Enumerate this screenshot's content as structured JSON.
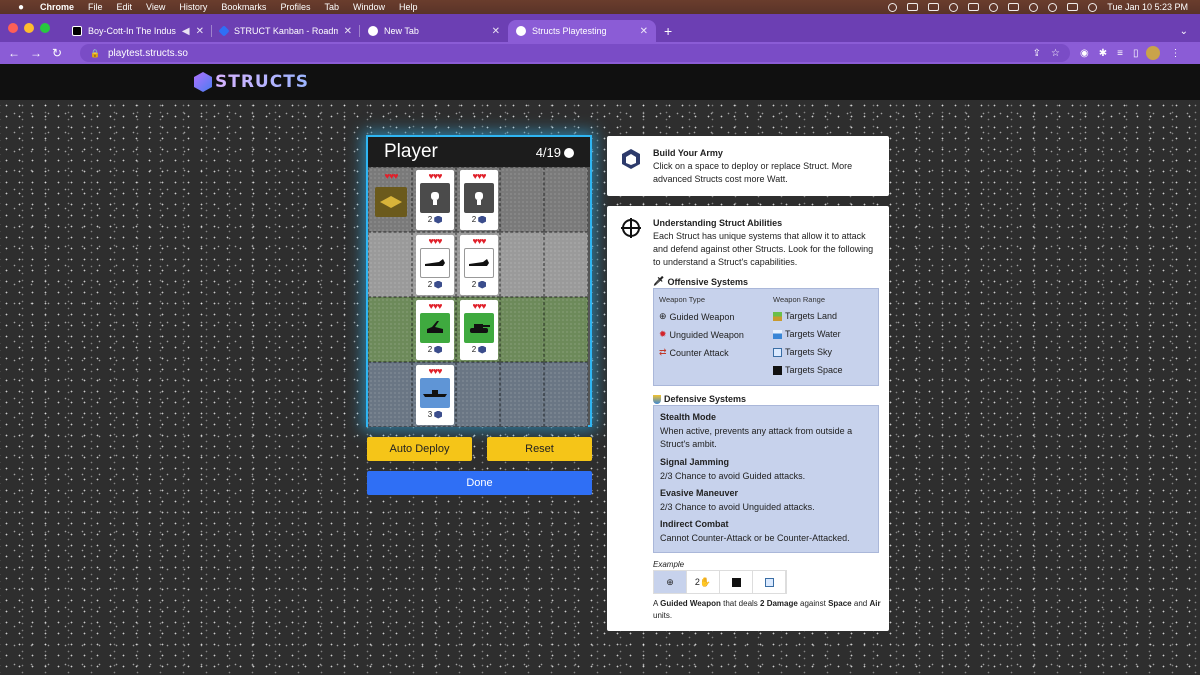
{
  "menubar": {
    "app": "Chrome",
    "items": [
      "File",
      "Edit",
      "View",
      "History",
      "Bookmarks",
      "Profiles",
      "Tab",
      "Window",
      "Help"
    ],
    "clock": "Tue Jan 10  5:23 PM"
  },
  "tabs": [
    {
      "title": "Boy-Cott-In The Industry |",
      "favicon_color": "#000000"
    },
    {
      "title": "STRUCT Kanban - Roadmap -",
      "favicon_color": "#2f6ff5"
    },
    {
      "title": "New Tab",
      "favicon_color": "#ffffff"
    },
    {
      "title": "Structs Playtesting",
      "favicon_color": "#ffffff",
      "active": true
    }
  ],
  "address": {
    "url": "playtest.structs.so"
  },
  "site": {
    "logo_text": "STRUCTS"
  },
  "board": {
    "player_label": "Player",
    "count": "4/19",
    "cards": [
      {
        "hearts": "♥♥♥"
      },
      {
        "hearts": "♥♥♥",
        "cost": "2"
      },
      {
        "hearts": "♥♥♥",
        "cost": "2"
      },
      {
        "hearts": "♥♥♥",
        "cost": "2"
      },
      {
        "hearts": "♥♥♥",
        "cost": "2"
      },
      {
        "hearts": "♥♥♥",
        "cost": "2"
      },
      {
        "hearts": "♥♥♥",
        "cost": "2"
      },
      {
        "hearts": "♥♥♥",
        "cost": "3"
      }
    ]
  },
  "buttons": {
    "auto_deploy": "Auto Deploy",
    "reset": "Reset",
    "done": "Done"
  },
  "build_panel": {
    "title": "Build Your Army",
    "text": "Click on a space to deploy or replace Struct. More advanced Structs cost more Watt."
  },
  "abilities_panel": {
    "title": "Understanding Struct Abilities",
    "text": "Each Struct has unique systems that allow it to attack and defend against other Structs. Look for the following to understand a Struct's capabilities.",
    "offensive": {
      "title": "Offensive Systems",
      "col1_header": "Weapon Type",
      "col2_header": "Weapon Range",
      "types": [
        "Guided Weapon",
        "Unguided Weapon",
        "Counter Attack"
      ],
      "ranges": [
        "Targets Land",
        "Targets Water",
        "Targets Sky",
        "Targets Space"
      ]
    },
    "defensive": {
      "title": "Defensive Systems",
      "items": [
        {
          "name": "Stealth Mode",
          "desc": "When active, prevents any attack from outside a Struct's ambit."
        },
        {
          "name": "Signal Jamming",
          "desc": "2/3 Chance to avoid Guided attacks."
        },
        {
          "name": "Evasive Maneuver",
          "desc": "2/3 Chance to avoid Unguided attacks."
        },
        {
          "name": "Indirect Combat",
          "desc": "Cannot Counter-Attack or be Counter-Attacked."
        }
      ]
    },
    "example": {
      "label": "Example",
      "damage": "2",
      "note_1": "A ",
      "note_bold_1": "Guided Weapon",
      "note_2": " that deals ",
      "note_bold_2": "2 Damage",
      "note_3": " against ",
      "note_bold_3": "Space",
      "note_4": " and ",
      "note_bold_4": "Air",
      "note_5": " units."
    }
  },
  "colors": {
    "board_glow": "#2fb6f3",
    "yellow_button": "#f5c518",
    "blue_button": "#2f6ff5",
    "browser_purple": "#8b5cd6"
  }
}
